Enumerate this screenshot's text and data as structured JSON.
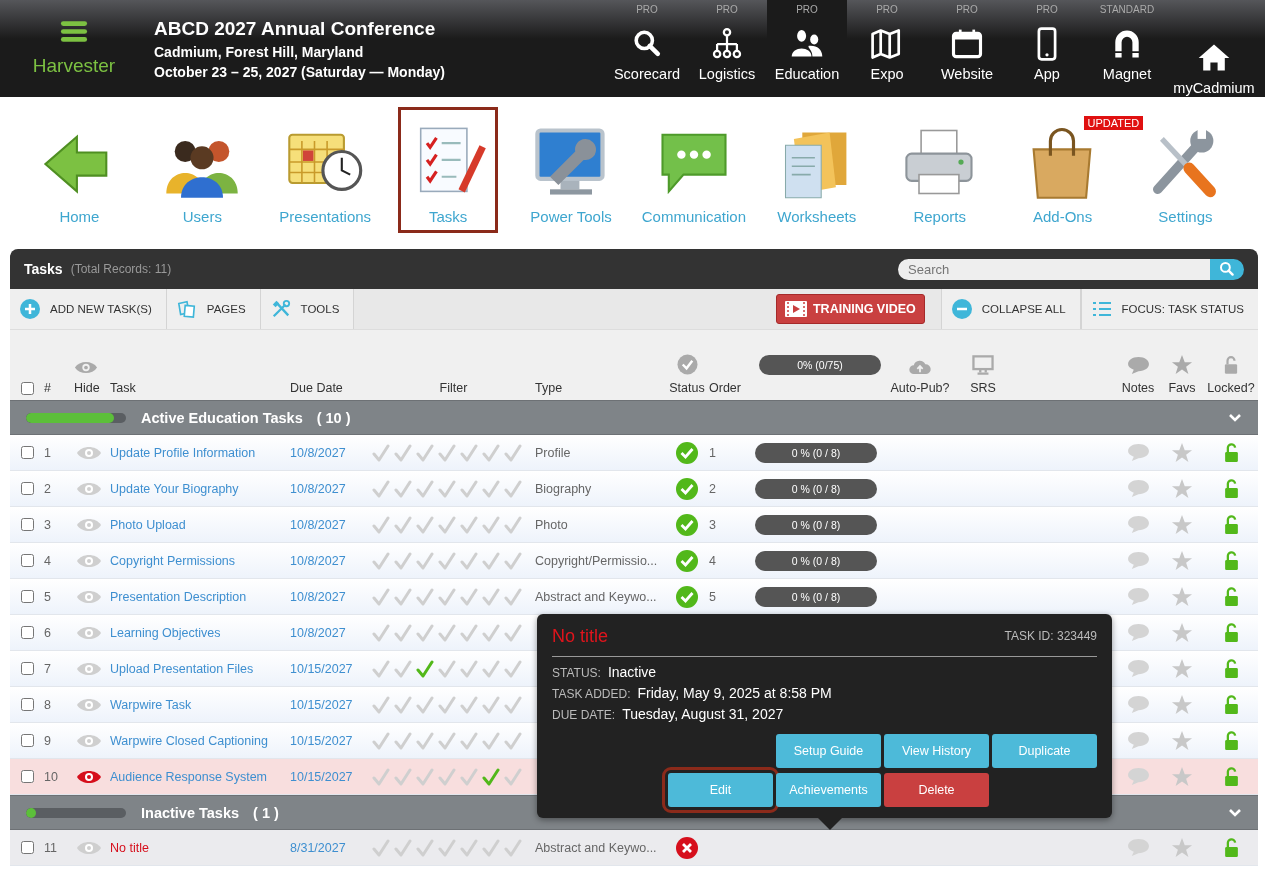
{
  "brand": {
    "name": "Harvester"
  },
  "event": {
    "title": "ABCD 2027 Annual Conference",
    "location": "Cadmium, Forest Hill, Maryland",
    "dates": "October 23 – 25, 2027 (Saturday — Monday)"
  },
  "nav": [
    {
      "tier": "PRO",
      "label": "Scorecard",
      "selected": false
    },
    {
      "tier": "PRO",
      "label": "Logistics",
      "selected": false
    },
    {
      "tier": "PRO",
      "label": "Education",
      "selected": true
    },
    {
      "tier": "PRO",
      "label": "Expo",
      "selected": false
    },
    {
      "tier": "PRO",
      "label": "Website",
      "selected": false
    },
    {
      "tier": "PRO",
      "label": "App",
      "selected": false
    },
    {
      "tier": "STANDARD",
      "label": "Magnet",
      "selected": false
    },
    {
      "label": "myCadmium",
      "selected": false
    }
  ],
  "apps": [
    {
      "label": "Home",
      "selected": false
    },
    {
      "label": "Users",
      "selected": false
    },
    {
      "label": "Presentations",
      "selected": false
    },
    {
      "label": "Tasks",
      "selected": true
    },
    {
      "label": "Power Tools",
      "selected": false
    },
    {
      "label": "Communication",
      "selected": false
    },
    {
      "label": "Worksheets",
      "selected": false
    },
    {
      "label": "Reports",
      "selected": false
    },
    {
      "label": "Add-Ons",
      "selected": false,
      "badge": "UPDATED"
    },
    {
      "label": "Settings",
      "selected": false
    }
  ],
  "panel": {
    "title": "Tasks",
    "total": "(Total Records: 11)",
    "search": {
      "placeholder": "Search"
    }
  },
  "toolbar": {
    "left": [
      {
        "label": "ADD NEW TASK(S)"
      },
      {
        "label": "PAGES"
      },
      {
        "label": "TOOLS"
      }
    ],
    "video": {
      "label": "TRAINING VIDEO"
    },
    "right": [
      {
        "label": "COLLAPSE ALL"
      },
      {
        "label": "FOCUS: TASK STATUS"
      }
    ]
  },
  "columns": {
    "select_all": false,
    "number": "#",
    "hide": "Hide",
    "task": "Task",
    "due": "Due Date",
    "filter": "Filter",
    "type": "Type",
    "status": "Status",
    "order": "Order",
    "progress": {
      "text": "0% (0/75)",
      "level": 0
    },
    "autopub": "Auto-Pub?",
    "srs": "SRS",
    "notes": "Notes",
    "favs": "Favs",
    "locked": "Locked?"
  },
  "groups": [
    {
      "title": "Active Education Tasks",
      "count": "( 10 )",
      "level": 0.88,
      "rows": [
        {
          "checked": false,
          "number": "1",
          "hidden": false,
          "task": "Update Profile Information",
          "due": "10/8/2027",
          "filters": [
            false,
            false,
            false,
            false,
            false,
            false,
            false
          ],
          "type": "Profile",
          "complete": true,
          "order": "1",
          "progress": {
            "text": "0 % (0 / 8)",
            "level": 0
          }
        },
        {
          "checked": false,
          "number": "2",
          "hidden": false,
          "task": "Update Your Biography",
          "due": "10/8/2027",
          "filters": [
            false,
            false,
            false,
            false,
            false,
            false,
            false
          ],
          "type": "Biography",
          "complete": true,
          "order": "2",
          "progress": {
            "text": "0 % (0 / 8)",
            "level": 0
          }
        },
        {
          "checked": false,
          "number": "3",
          "hidden": false,
          "task": "Photo Upload",
          "due": "10/8/2027",
          "filters": [
            false,
            false,
            false,
            false,
            false,
            false,
            false
          ],
          "type": "Photo",
          "complete": true,
          "order": "3",
          "progress": {
            "text": "0 % (0 / 8)",
            "level": 0
          }
        },
        {
          "checked": false,
          "number": "4",
          "hidden": false,
          "task": "Copyright Permissions",
          "due": "10/8/2027",
          "filters": [
            false,
            false,
            false,
            false,
            false,
            false,
            false
          ],
          "type": "Copyright/Permissio...",
          "complete": true,
          "order": "4",
          "progress": {
            "text": "0 % (0 / 8)",
            "level": 0
          }
        },
        {
          "checked": false,
          "number": "5",
          "hidden": false,
          "task": "Presentation Description",
          "due": "10/8/2027",
          "filters": [
            false,
            false,
            false,
            false,
            false,
            false,
            false
          ],
          "type": "Abstract and Keywo...",
          "complete": true,
          "order": "5",
          "progress": {
            "text": "0 % (0 / 8)",
            "level": 0
          }
        },
        {
          "checked": false,
          "number": "6",
          "hidden": false,
          "task": "Learning Objectives",
          "due": "10/8/2027",
          "filters": [
            false,
            false,
            false,
            false,
            false,
            false,
            false
          ]
        },
        {
          "checked": false,
          "number": "7",
          "hidden": false,
          "task": "Upload Presentation Files",
          "due": "10/15/2027",
          "filters": [
            false,
            false,
            true,
            false,
            false,
            false,
            false
          ]
        },
        {
          "checked": false,
          "number": "8",
          "hidden": false,
          "task": "Warpwire Task",
          "due": "10/15/2027",
          "filters": [
            false,
            false,
            false,
            false,
            false,
            false,
            false
          ]
        },
        {
          "checked": false,
          "number": "9",
          "hidden": false,
          "task": "Warpwire Closed Captioning",
          "due": "10/15/2027",
          "filters": [
            false,
            false,
            false,
            false,
            false,
            false,
            false
          ]
        },
        {
          "checked": false,
          "number": "10",
          "hidden": true,
          "task": "Audience Response System",
          "due": "10/15/2027",
          "filters": [
            false,
            false,
            false,
            false,
            false,
            true,
            false
          ]
        }
      ]
    },
    {
      "title": "Inactive Tasks",
      "count": "( 1 )",
      "level": 0.1,
      "rows": [
        {
          "checked": false,
          "number": "11",
          "hidden": false,
          "task": "No title",
          "due": "8/31/2027",
          "filters": [
            false,
            false,
            false,
            false,
            false,
            false,
            false
          ],
          "type": "Abstract and Keywo...",
          "complete": false
        }
      ]
    }
  ],
  "popup": {
    "title": "No title",
    "task_id": "TASK ID: 323449",
    "fields": [
      {
        "label": "STATUS:",
        "value": "Inactive"
      },
      {
        "label": "TASK ADDED:",
        "value": "Friday, May 9, 2025 at 8:58 PM"
      },
      {
        "label": "DUE DATE:",
        "value": "Tuesday, August 31, 2027"
      }
    ],
    "button_rows": [
      [
        {
          "label": "Setup Guide",
          "kind": "info",
          "highlighted": false
        },
        {
          "label": "View History",
          "kind": "info",
          "highlighted": false
        },
        {
          "label": "Duplicate",
          "kind": "info",
          "highlighted": false
        }
      ],
      [
        {
          "label": "Edit",
          "kind": "info",
          "highlighted": true
        },
        {
          "label": "Achievements",
          "kind": "info",
          "highlighted": false
        },
        {
          "label": "Delete",
          "kind": "danger",
          "highlighted": false
        }
      ]
    ]
  }
}
